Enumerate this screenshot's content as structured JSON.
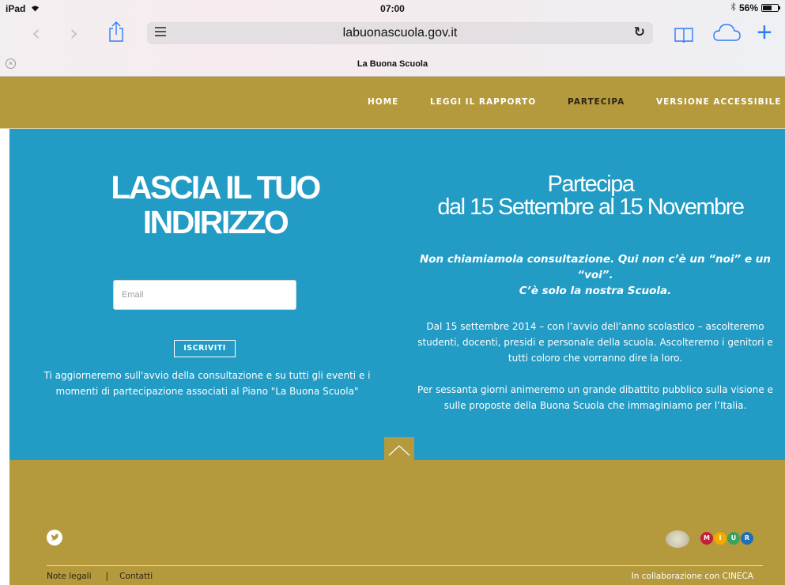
{
  "status_bar": {
    "device": "iPad",
    "time": "07:00",
    "battery": "56%"
  },
  "browser": {
    "url": "labuonascuola.gov.it",
    "tab_title": "La Buona Scuola",
    "icons": [
      "back-icon",
      "forward-icon",
      "share-icon",
      "reader-icon",
      "reload-icon",
      "bookmarks-icon",
      "icloud-tabs-icon",
      "new-tab-icon",
      "close-tab-icon"
    ]
  },
  "nav": {
    "items": [
      "HOME",
      "LEGGI IL RAPPORTO",
      "PARTECIPA",
      "VERSIONE ACCESSIBILE"
    ],
    "active": "PARTECIPA"
  },
  "signup": {
    "title_line1": "LASCIA IL TUO",
    "title_line2": "INDIRIZZO",
    "email_placeholder": "Email",
    "email_value": "",
    "button": "ISCRIVITI",
    "info": "Ti aggiorneremo sull'avvio della consultazione e su tutti gli eventi e i momenti di partecipazione associati al Piano \"La Buona Scuola\""
  },
  "participate": {
    "title_line1": "Partecipa",
    "title_line2": "dal 15 Settembre al 15 Novembre",
    "tagline_line1": "Non chiamiamola consultazione. Qui non c’è un “noi” e un “voi”.",
    "tagline_line2": "C’è solo la nostra Scuola.",
    "paragraph1": "Dal 15 settembre 2014 – con l’avvio dell’anno scolastico – ascolteremo studenti, docenti, presidi e personale della scuola. Ascolteremo i genitori e tutti coloro che vorranno dire la loro.",
    "paragraph2": "Per sessanta giorni animeremo un grande dibattito pubblico sulla visione e sulle proposte della Buona Scuola che immaginiamo per l’Italia."
  },
  "footer": {
    "links": [
      "Note legali",
      "Contatti"
    ],
    "separator": "|",
    "collaboration": "In collaborazione con CINECA",
    "miur_letters": [
      "M",
      "I",
      "U",
      "R"
    ]
  },
  "colors": {
    "gold": "#b49a3d",
    "blue": "#229bc5",
    "ios_blue": "#2e7cf6",
    "miur": [
      "#c4203c",
      "#f2a900",
      "#3aa35b",
      "#1e6fb8"
    ]
  }
}
